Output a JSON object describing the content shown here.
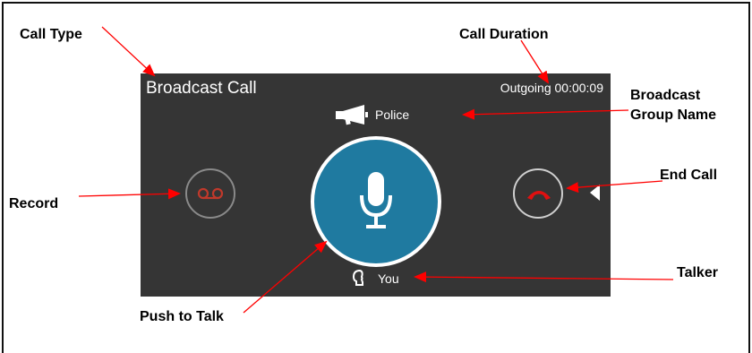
{
  "annotations": {
    "call_type": "Call Type",
    "call_duration": "Call Duration",
    "broadcast_group_name_line1": "Broadcast",
    "broadcast_group_name_line2": "Group Name",
    "end_call": "End Call",
    "record": "Record",
    "talker": "Talker",
    "push_to_talk": "Push to Talk"
  },
  "call": {
    "type_title": "Broadcast Call",
    "duration": "Outgoing 00:00:09",
    "group_name": "Police",
    "talker": "You"
  },
  "icons": {
    "group": "megaphone-icon",
    "ptt": "microphone-icon",
    "record": "voicemail-icon",
    "end_call": "hang-up-icon",
    "talker": "speaking-head-icon",
    "collapse": "triangle-left-icon"
  },
  "colors": {
    "panel": "#353535",
    "ptt": "#1f7aa0",
    "record_icon": "#c0392b",
    "end_call_icon": "#e01010",
    "arrow": "#ff0000"
  }
}
